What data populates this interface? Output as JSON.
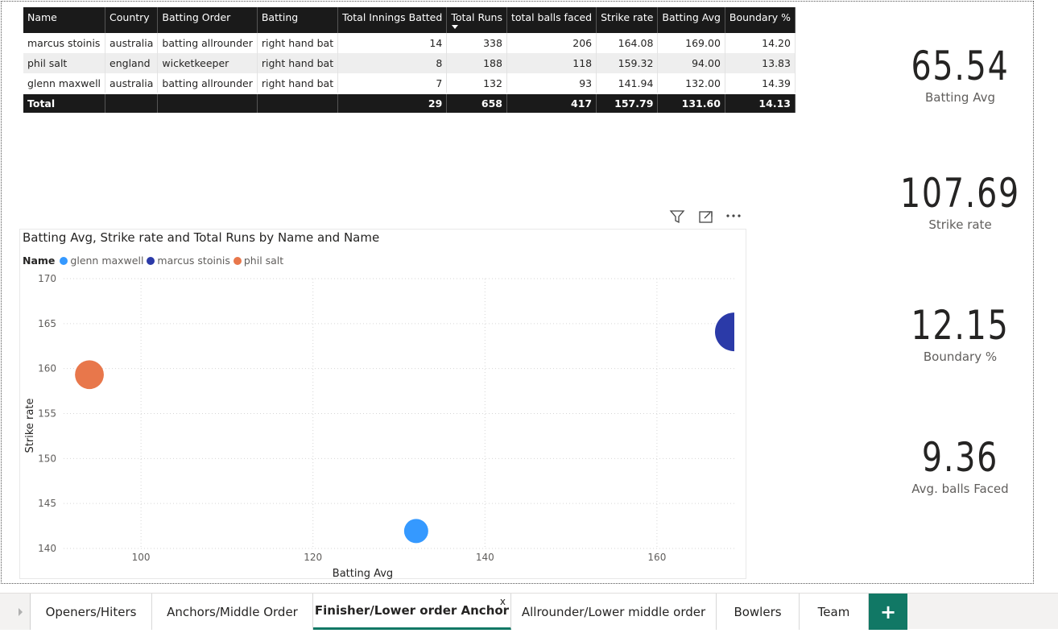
{
  "table": {
    "headers": [
      "Name",
      "Country",
      "Batting Order",
      "Batting",
      "Total Innings Batted",
      "Total Runs",
      "total balls faced",
      "Strike rate",
      "Batting Avg",
      "Boundary %"
    ],
    "rows": [
      [
        "marcus stoinis",
        "australia",
        "batting allrounder",
        "right hand bat",
        "14",
        "338",
        "206",
        "164.08",
        "169.00",
        "14.20"
      ],
      [
        "phil salt",
        "england",
        "wicketkeeper",
        "right hand bat",
        "8",
        "188",
        "118",
        "159.32",
        "94.00",
        "13.83"
      ],
      [
        "glenn maxwell",
        "australia",
        "batting allrounder",
        "right hand bat",
        "7",
        "132",
        "93",
        "141.94",
        "132.00",
        "14.39"
      ]
    ],
    "total": [
      "Total",
      "",
      "",
      "",
      "29",
      "658",
      "417",
      "157.79",
      "131.60",
      "14.13"
    ]
  },
  "kpis": [
    {
      "value": "65.54",
      "label": "Batting Avg"
    },
    {
      "value": "107.69",
      "label": "Strike rate"
    },
    {
      "value": "12.15",
      "label": "Boundary %"
    },
    {
      "value": "9.36",
      "label": "Avg. balls Faced"
    }
  ],
  "visual_icons": [
    "filter-icon",
    "focus-mode-icon",
    "more-options-icon"
  ],
  "chart_data": {
    "type": "scatter",
    "title": "Batting Avg, Strike rate and Total Runs by Name and Name",
    "legend_title": "Name",
    "legend_placement": "top-left",
    "xlabel": "Batting Avg",
    "ylabel": "Strike rate",
    "xlim": [
      91,
      169
    ],
    "ylim": [
      140,
      170
    ],
    "xticks": [
      100,
      120,
      140,
      160
    ],
    "yticks": [
      140,
      145,
      150,
      155,
      160,
      165,
      170
    ],
    "grid": true,
    "series": [
      {
        "name": "glenn maxwell",
        "color": "#3599ff",
        "x": 132.0,
        "y": 141.94,
        "size": 132
      },
      {
        "name": "marcus stoinis",
        "color": "#2b3aa8",
        "x": 169.0,
        "y": 164.08,
        "size": 338
      },
      {
        "name": "phil salt",
        "color": "#e8774b",
        "x": 94.0,
        "y": 159.32,
        "size": 188
      }
    ]
  },
  "tabs": [
    {
      "label": "Openers/Hiters",
      "active": false
    },
    {
      "label": "Anchors/Middle Order",
      "active": false
    },
    {
      "label": "Finisher/Lower order Anchor",
      "active": true
    },
    {
      "label": "Allrounder/Lower middle order",
      "active": false
    },
    {
      "label": "Bowlers",
      "active": false
    },
    {
      "label": "Team",
      "active": false
    }
  ],
  "tab_close_label": "x",
  "add_tab_label": "+"
}
